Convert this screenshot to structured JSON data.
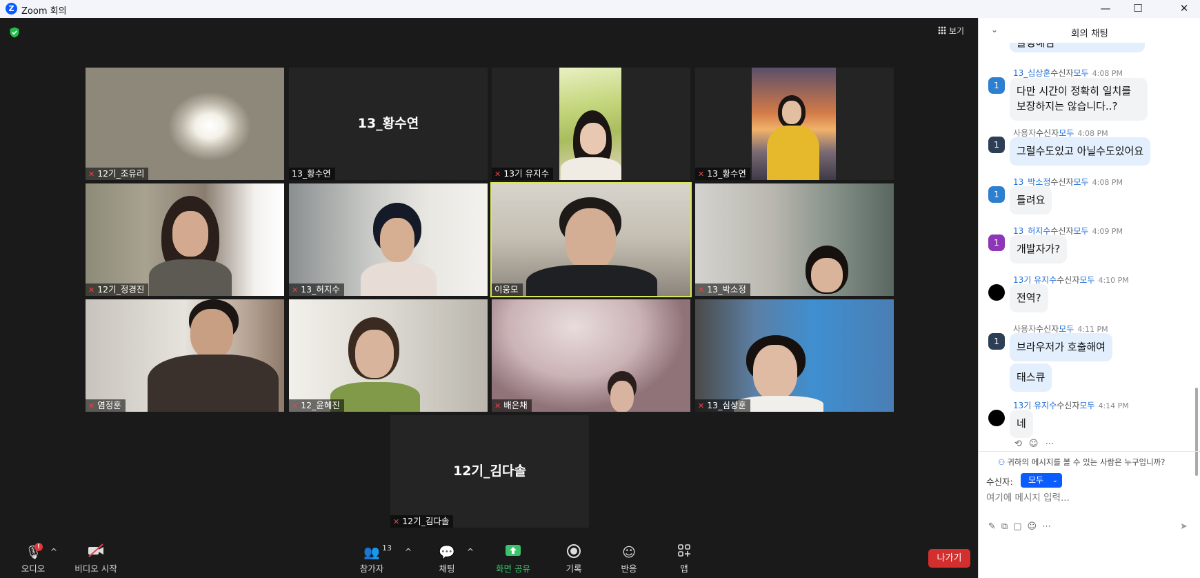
{
  "window": {
    "title": "Zoom 회의",
    "logo_letter": "Z",
    "minimize": "—",
    "maximize": "☐",
    "close": "✕"
  },
  "stage": {
    "view_label": "보기",
    "tiles": [
      {
        "name": "12기_조유리",
        "muted": true,
        "video": true
      },
      {
        "name": "13_황수연",
        "muted": false,
        "video": false,
        "big_name": "13_황수연"
      },
      {
        "name": "13기 유지수",
        "muted": true,
        "video": true
      },
      {
        "name": "13_황수연",
        "muted": true,
        "video": true
      },
      {
        "name": "12기_정경진",
        "muted": true,
        "video": true
      },
      {
        "name": "13_허지수",
        "muted": true,
        "video": true
      },
      {
        "name": "이웅모",
        "muted": false,
        "video": true,
        "active_speaker": true
      },
      {
        "name": "13_박소정",
        "muted": true,
        "video": true
      },
      {
        "name": "염정훈",
        "muted": true,
        "video": true
      },
      {
        "name": "12_윤혜진",
        "muted": true,
        "video": true
      },
      {
        "name": "배은채",
        "muted": true,
        "video": true
      },
      {
        "name": "13_심상훈",
        "muted": true,
        "video": true
      },
      {
        "name": "12기_김다솔",
        "muted": true,
        "video": false,
        "big_name": "12기_김다솔"
      }
    ]
  },
  "toolbar": {
    "audio_label": "오디오",
    "audio_badge": "!",
    "video_label": "비디오 시작",
    "participants_label": "참가자",
    "participants_count": "13",
    "chat_label": "채팅",
    "share_label": "화면 공유",
    "record_label": "기록",
    "reactions_label": "반응",
    "apps_label": "앱",
    "leave_label": "나가기"
  },
  "chat": {
    "title": "회의 채팅",
    "partial_text": "클링해님",
    "messages": [
      {
        "sender": "13_심상훈",
        "to_word": "수신자",
        "to": "모두",
        "time": "4:08 PM",
        "text": "다만 시간이 정확히 일치를 보장하지는 않습니다..?",
        "avatar": "1",
        "avatar_color": "#2d7fd0"
      },
      {
        "sender": "사용자",
        "to_word": "수신자",
        "to": "모두",
        "time": "4:08 PM",
        "text": "그럴수도있고 아닐수도있어요",
        "avatar": "1",
        "avatar_color": "#2d3f55"
      },
      {
        "sender": "13_박소정",
        "to_word": "수신자",
        "to": "모두",
        "time": "4:08 PM",
        "text": "틀려요",
        "avatar": "1",
        "avatar_color": "#2d7fd0"
      },
      {
        "sender": "13_허지수",
        "to_word": "수신자",
        "to": "모두",
        "time": "4:09 PM",
        "text": "개발자가?",
        "avatar": "1",
        "avatar_color": "#8e35b8"
      },
      {
        "sender": "13기 유지수",
        "to_word": "수신자",
        "to": "모두",
        "time": "4:10 PM",
        "text": "전역?",
        "avatar": "",
        "avatar_color": "#000000"
      },
      {
        "sender": "사용자",
        "to_word": "수신자",
        "to": "모두",
        "time": "4:11 PM",
        "text": "브라우저가 호출해여",
        "text2": "태스큐",
        "avatar": "1",
        "avatar_color": "#2d3f55"
      },
      {
        "sender": "13기 유지수",
        "to_word": "수신자",
        "to": "모두",
        "time": "4:14 PM",
        "text": "네",
        "avatar": "",
        "avatar_color": "#000000"
      }
    ],
    "visibility_note": "귀하의 메시지를 볼 수 있는 사람은 누구입니까?",
    "recipient_label": "수신자:",
    "recipient_value": "모두",
    "input_placeholder": "여기에 메시지 입력..."
  },
  "colors": {
    "accent": "#0b5cff",
    "leave": "#d32f2f",
    "share": "#3ac36b",
    "active_speaker_border": "#d9e85a",
    "muted_icon": "#e0474c"
  }
}
